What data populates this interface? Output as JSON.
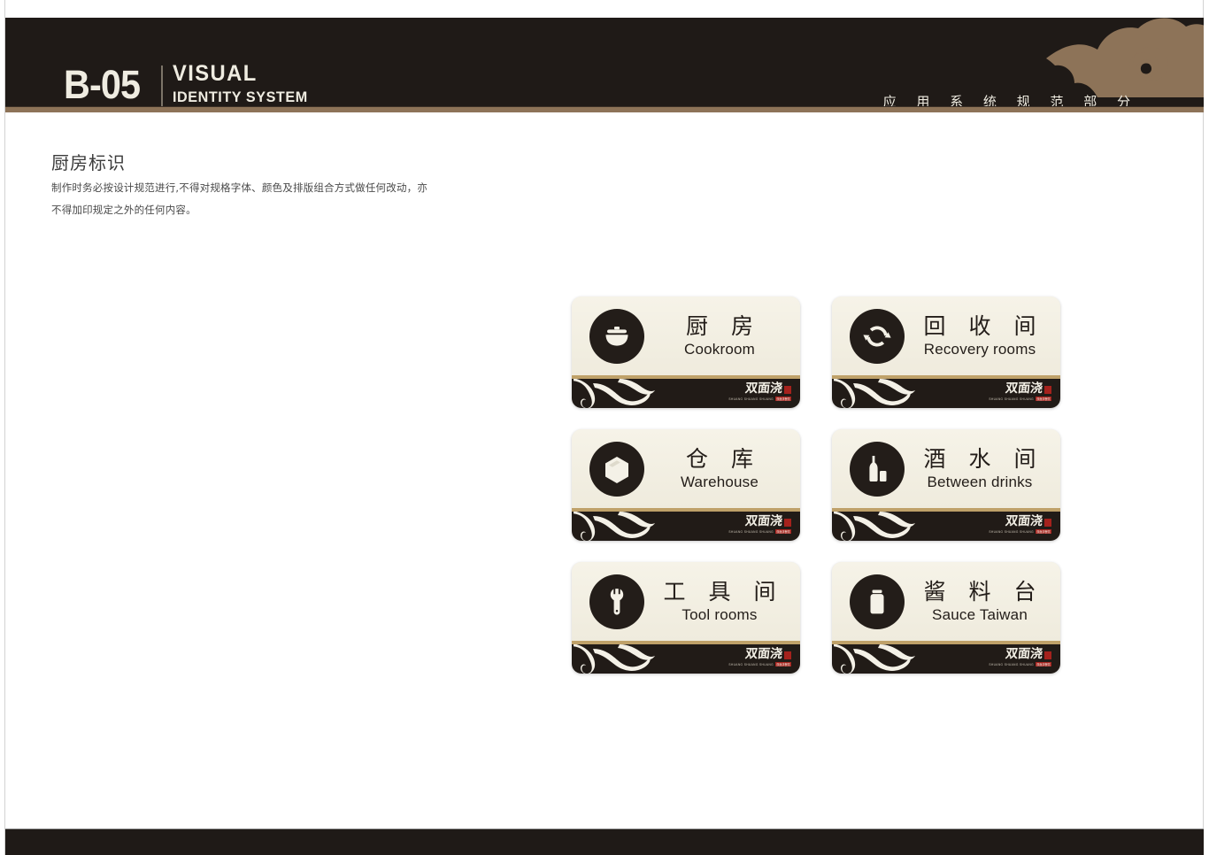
{
  "header": {
    "code": "B-05",
    "system_line1": "VISUAL",
    "system_line2": "IDENTITY SYSTEM",
    "section_cn": "应 用 系 统 规 范 部 分",
    "cloud_icon": "auspicious-cloud-ornament",
    "bg_color": "#1f1a17",
    "rule_color": "#8d7358",
    "text_color": "#efece1"
  },
  "section": {
    "title": "厨房标识",
    "description_line1": "制作时务必按设计规范进行,不得对规格字体、颜色及排版组合方式做任何改动，亦",
    "description_line2": "不得加印规定之外的任何内容。"
  },
  "brand": {
    "name_cn": "双面浇",
    "pinyin": "SHUANG  SHUANG  SHUANG",
    "tag": "双面浇餐饮",
    "seal_color": "#a5221d"
  },
  "sign_style": {
    "plate_color": "#f2eee1",
    "band_color": "#211b17",
    "gold_line_color": "#bfa169",
    "icon_circle_color": "#231d19",
    "wave_color": "#f4f1e7"
  },
  "signs": [
    {
      "icon": "pot-icon",
      "cn": "厨 房",
      "en": "Cookroom"
    },
    {
      "icon": "recycle-icon",
      "cn": "回 收 间",
      "en": "Recovery rooms"
    },
    {
      "icon": "box-icon",
      "cn": "仓 库",
      "en": "Warehouse"
    },
    {
      "icon": "bottle-icon",
      "cn": "酒 水 间",
      "en": "Between drinks"
    },
    {
      "icon": "wrench-icon",
      "cn": "工 具 间",
      "en": "Tool rooms"
    },
    {
      "icon": "jar-icon",
      "cn": "酱 料 台",
      "en": "Sauce Taiwan"
    }
  ]
}
